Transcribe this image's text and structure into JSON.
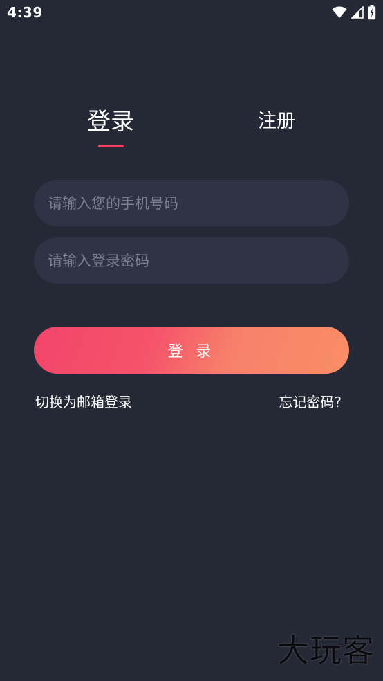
{
  "status_bar": {
    "time": "4:39",
    "icons": [
      "wifi-icon",
      "signal-icon",
      "battery-icon"
    ]
  },
  "tabs": [
    {
      "label": "登录",
      "active": true
    },
    {
      "label": "注册",
      "active": false
    }
  ],
  "form": {
    "phone_placeholder": "请输入您的手机号码",
    "password_placeholder": "请输入登录密码",
    "submit_label": "登 录"
  },
  "links": {
    "switch_email": "切换为邮箱登录",
    "forgot_password": "忘记密码?"
  },
  "watermark": "大玩客",
  "colors": {
    "background": "#252835",
    "field": "#2f3345",
    "accent": "#f0406a",
    "gradient_start": "#f2446a",
    "gradient_end": "#f98e66"
  }
}
